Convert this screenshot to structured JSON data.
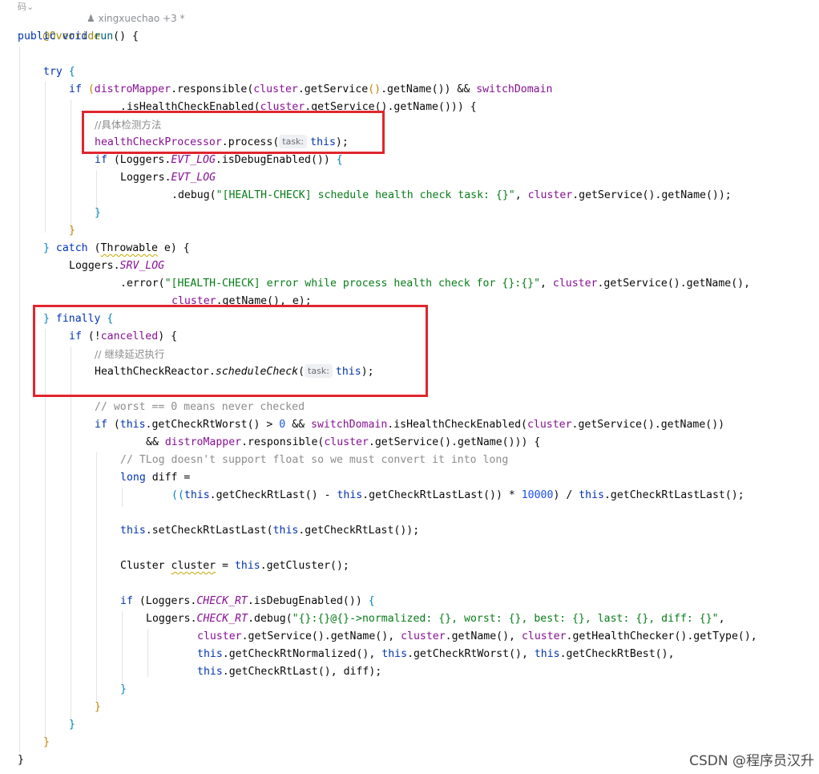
{
  "editor": {
    "author_hint": "xingxuechao +3 *",
    "gutter_icon": "码⌄",
    "lines": {
      "override": "@Override",
      "public": "public",
      "void": "void",
      "run": "run",
      "run_paren": "() {",
      "try": "try",
      "try_brace": " {",
      "if1_kw": "if",
      "if1_a": " (",
      "distroMapper": "distroMapper",
      "responsible": ".responsible(",
      "cluster": "cluster",
      "getService": ".getService",
      "getName": ".getName",
      "if1_and": " && ",
      "switchDomain": "switchDomain",
      "l2_a": ".isHealthCheckEnabled(",
      "l2_b": ".getService",
      "l2_c": "().getName",
      "l2_d": "())) {",
      "comment1": "//具体检测方法",
      "hcp": "healthCheckProcessor",
      "process": ".process(",
      "hint_task": "task:",
      "this": "this",
      "close_semi": ");",
      "if2_kw": "if",
      "loggers": "Loggers",
      "evt_log": "EVT_LOG",
      "isDebugEnabled": ".isDebugEnabled()",
      "brace_open": " {",
      "debug": ".debug(",
      "debug_str": "\"[HEALTH-CHECK] schedule health check task: {}\"",
      "comma": ", ",
      "tail1": ".getService().getName());",
      "rbrace": "}",
      "catch_kw": "catch",
      "throwable": "Throwable",
      "e_brace": " e) {",
      "srv_log": "SRV_LOG",
      "error": ".error(",
      "error_str": "\"[HEALTH-CHECK] error while process health check for {}:{}\"",
      "tail2": ".getService().getName(),",
      "tail3": ".getName(), e);",
      "finally_kw": "finally",
      "not": " (!",
      "cancelled": "cancelled",
      "close_brace": ") {",
      "comment2": "// 继续延迟执行",
      "hcr": "HealthCheckReactor",
      "scheduleCheck": "scheduleCheck",
      "comment3": "// worst == 0 means never checked",
      "getCheckRtWorst": ".getCheckRtWorst()",
      "gt": " > ",
      "zero": "0",
      "and": " && ",
      "isHCE": ".isHealthCheckEnabled(",
      "tail4": ".getService().getName())",
      "and2": "&& ",
      "tail5": ".getService().getName())) {",
      "comment4": "// TLog doesn't support float so we must convert it into long",
      "long_kw": "long",
      "diff_assign": " diff =",
      "expr_a": "((",
      "getLast": ".getCheckRtLast()",
      "minus": " - ",
      "getLastLast": ".getCheckRtLastLast())",
      "times": " * ",
      "num10000": "10000",
      "div": ") / ",
      "getLastLastEnd": ".getCheckRtLastLast();",
      "setLL": ".setCheckRtLastLast(",
      "getLastEnd": ".getCheckRtLast());",
      "cluster_type": "Cluster ",
      "cluster_var": "cluster",
      "eq": " = ",
      "getCluster": ".getCluster();",
      "check_rt": "CHECK_RT",
      "debug2": ".debug(",
      "debug2_str": "\"{}:{}@{}->normalized: {}, worst: {}, best: {}, last: {}, diff: {}\"",
      "l_a1": ".getService().getName(), ",
      "l_a2": ".getName(), ",
      "l_a3": ".getHealthChecker().getType(),",
      "l_b1": ".getCheckRtNormalized(), ",
      "l_b2": ".getCheckRtWorst(), ",
      "l_b3": ".getCheckRtBest(),",
      "l_c1": ".getCheckRtLast(), diff);"
    }
  },
  "watermark": "CSDN @程序员汉升"
}
